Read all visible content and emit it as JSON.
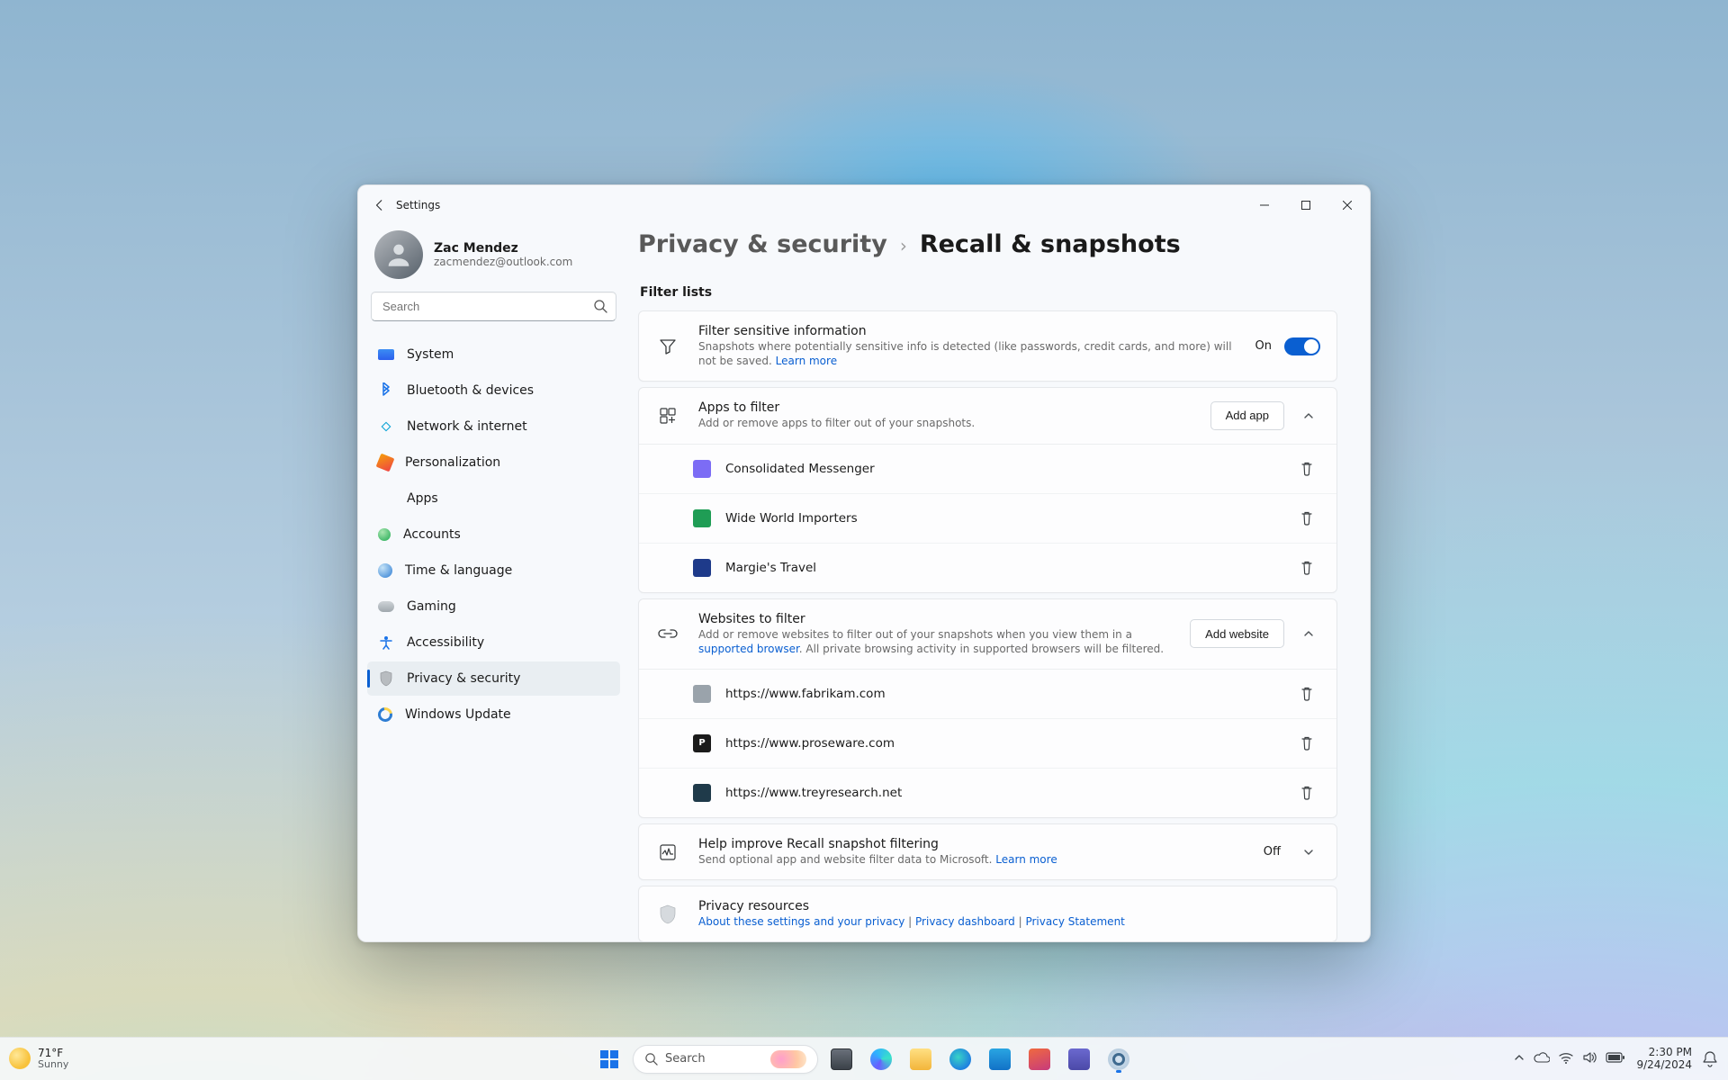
{
  "window": {
    "title": "Settings"
  },
  "weather": {
    "temp": "71°F",
    "cond": "Sunny"
  },
  "clock": {
    "time": "2:30 PM",
    "date": "9/24/2024"
  },
  "profile": {
    "name": "Zac Mendez",
    "email": "zacmendez@outlook.com"
  },
  "search": {
    "placeholder": "Search"
  },
  "taskbar_search": {
    "placeholder": "Search"
  },
  "nav": {
    "items": [
      "System",
      "Bluetooth & devices",
      "Network & internet",
      "Personalization",
      "Apps",
      "Accounts",
      "Time & language",
      "Gaming",
      "Accessibility",
      "Privacy & security",
      "Windows Update"
    ],
    "active": 9
  },
  "breadcrumbs": {
    "parent": "Privacy & security",
    "title": "Recall & snapshots"
  },
  "section": "Filter lists",
  "filter_sensitive": {
    "title": "Filter sensitive information",
    "desc": "Snapshots where potentially sensitive info is detected (like passwords, credit cards, and more) will not be saved.",
    "learn_more": "Learn more",
    "state_label": "On",
    "state": true
  },
  "apps_filter": {
    "title": "Apps to filter",
    "desc": "Add or remove apps to filter out of your snapshots.",
    "add_button": "Add app",
    "items": [
      {
        "name": "Consolidated Messenger",
        "color": "#7c6cf5"
      },
      {
        "name": "Wide World Importers",
        "color": "#1f9d55"
      },
      {
        "name": "Margie's Travel",
        "color": "#1e3a8a"
      }
    ]
  },
  "websites_filter": {
    "title": "Websites to filter",
    "desc_pre": "Add or remove websites to filter out of your snapshots when you view them in a ",
    "link": "supported browser",
    "desc_post": ". All private browsing activity in supported browsers will be filtered.",
    "add_button": "Add website",
    "items": [
      {
        "url": "https://www.fabrikam.com",
        "color": "#9aa3ab"
      },
      {
        "url": "https://www.proseware.com",
        "color": "#1b1b1b"
      },
      {
        "url": "https://www.treyresearch.net",
        "color": "#1f3a4a"
      }
    ]
  },
  "improve": {
    "title": "Help improve Recall snapshot filtering",
    "desc": "Send optional app and website filter data to Microsoft.",
    "learn_more": "Learn more",
    "state_label": "Off"
  },
  "resources": {
    "title": "Privacy resources",
    "links": [
      "About these settings and your privacy",
      "Privacy dashboard",
      "Privacy Statement"
    ]
  }
}
